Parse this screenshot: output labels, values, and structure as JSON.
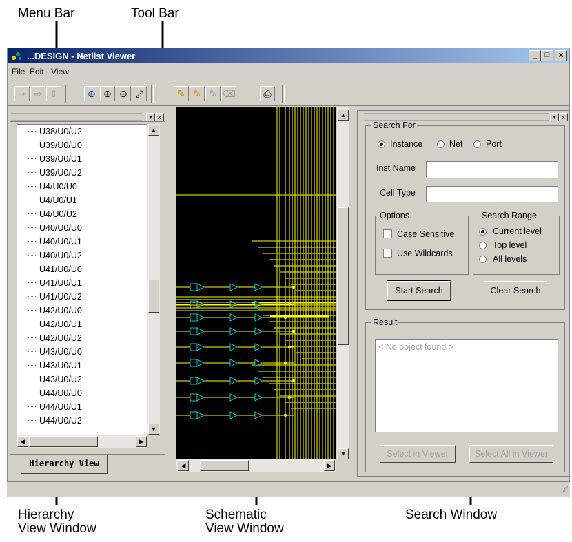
{
  "callouts": {
    "menu_bar": "Menu Bar",
    "tool_bar": "Tool Bar",
    "hierarchy_view_line1": "Hierarchy",
    "hierarchy_view_line2": "View Window",
    "schematic_view_line1": "Schematic",
    "schematic_view_line2": "View Window",
    "search_window": "Search Window"
  },
  "window": {
    "title": "...DESIGN - Netlist Viewer",
    "caption_buttons": [
      "_",
      "□",
      "x"
    ]
  },
  "menu": [
    "File",
    "Edit",
    "View"
  ],
  "toolbar": {
    "icons": [
      "push-into-icon",
      "pop-out-icon",
      "go-top-icon",
      "zoom-area-icon",
      "zoom-in-icon",
      "zoom-out-icon",
      "fit-all-icon",
      "highlight-icon",
      "highlight-add-icon",
      "unhighlight-icon",
      "eraser-icon",
      "print-icon"
    ]
  },
  "hierarchy": {
    "items": [
      "U38/U0/U2",
      "U39/U0/U0",
      "U39/U0/U1",
      "U39/U0/U2",
      "U4/U0/U0",
      "U4/U0/U1",
      "U4/U0/U2",
      "U40/U0/U0",
      "U40/U0/U1",
      "U40/U0/U2",
      "U41/U0/U0",
      "U41/U0/U1",
      "U41/U0/U2",
      "U42/U0/U0",
      "U42/U0/U1",
      "U42/U0/U2",
      "U43/U0/U0",
      "U43/U0/U1",
      "U43/U0/U2",
      "U44/U0/U0",
      "U44/U0/U1",
      "U44/U0/U2"
    ],
    "tab_label": "Hierarchy View"
  },
  "search": {
    "search_for_label": "Search For",
    "type_options": [
      "Instance",
      "Net",
      "Port"
    ],
    "selected_type": "Instance",
    "inst_name_label": "Inst Name",
    "inst_name_value": "",
    "cell_type_label": "Cell Type",
    "cell_type_value": "",
    "options_label": "Options",
    "case_sensitive_label": "Case Sensitive",
    "case_sensitive": false,
    "use_wildcards_label": "Use Wildcards",
    "use_wildcards": false,
    "range_label": "Search Range",
    "range_options": [
      "Current level",
      "Top level",
      "All levels"
    ],
    "selected_range": "Current level",
    "start_label": "Start Search",
    "clear_label": "Clear Search"
  },
  "result": {
    "label": "Result",
    "placeholder": "< No object found >",
    "select_label": "Select in Viewer",
    "select_all_label": "Select All in Viewer"
  },
  "colors": {
    "titlebar_start": "#0a246a",
    "schematic_bg": "#000000",
    "wire": "#ffff00",
    "cell": "#00c8c8"
  }
}
